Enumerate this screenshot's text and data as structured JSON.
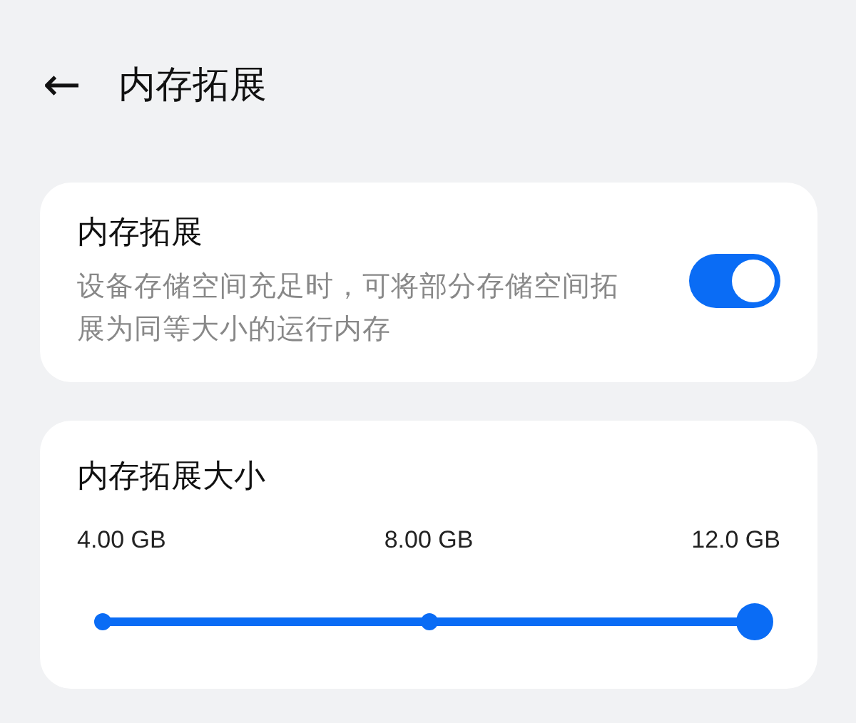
{
  "header": {
    "back": "←",
    "title": "内存拓展"
  },
  "expansion": {
    "title": "内存拓展",
    "description": "设备存储空间充足时，可将部分存储空间拓展为同等大小的运行内存",
    "on": true
  },
  "size": {
    "title": "内存拓展大小",
    "options": [
      {
        "label": "4.00 GB"
      },
      {
        "label": "8.00 GB"
      },
      {
        "label": "12.0 GB"
      }
    ],
    "level": 1
  }
}
